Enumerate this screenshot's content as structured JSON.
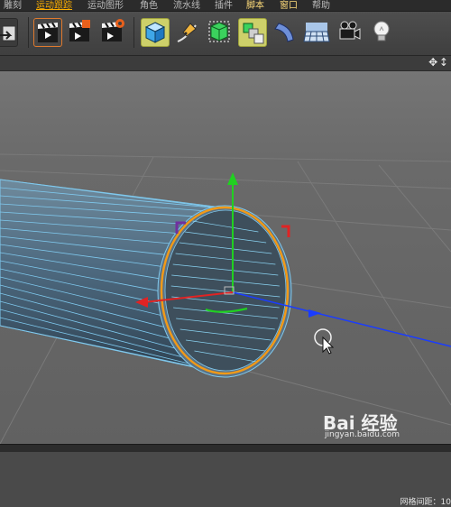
{
  "menu": {
    "items": [
      "雕刻",
      "运动跟踪",
      "运动图形",
      "角色",
      "流水线",
      "插件",
      "脚本",
      "窗口",
      "帮助"
    ]
  },
  "toolbar": {
    "groups": [
      {
        "name": "render",
        "buttons": [
          "render-view",
          "render-picture-viewer",
          "render-settings"
        ]
      },
      {
        "name": "create",
        "buttons": [
          "cube",
          "pen-spline",
          "subdivision-surface",
          "array",
          "deformer",
          "floor-environment",
          "camera",
          "light"
        ]
      }
    ]
  },
  "viewport": {
    "navigation_icons": "✥ ↕",
    "status_text": "网格间距：10",
    "object": "tube",
    "colors": {
      "background": "#6b6b6b",
      "wireframe": "#7fc9ee",
      "selection": "#f29a17",
      "axis_x": "#e02323",
      "axis_y": "#20d020",
      "axis_z": "#1a3cff"
    }
  },
  "watermark": {
    "logo_text": "Bai  经验",
    "url": "jingyan.baidu.com"
  }
}
